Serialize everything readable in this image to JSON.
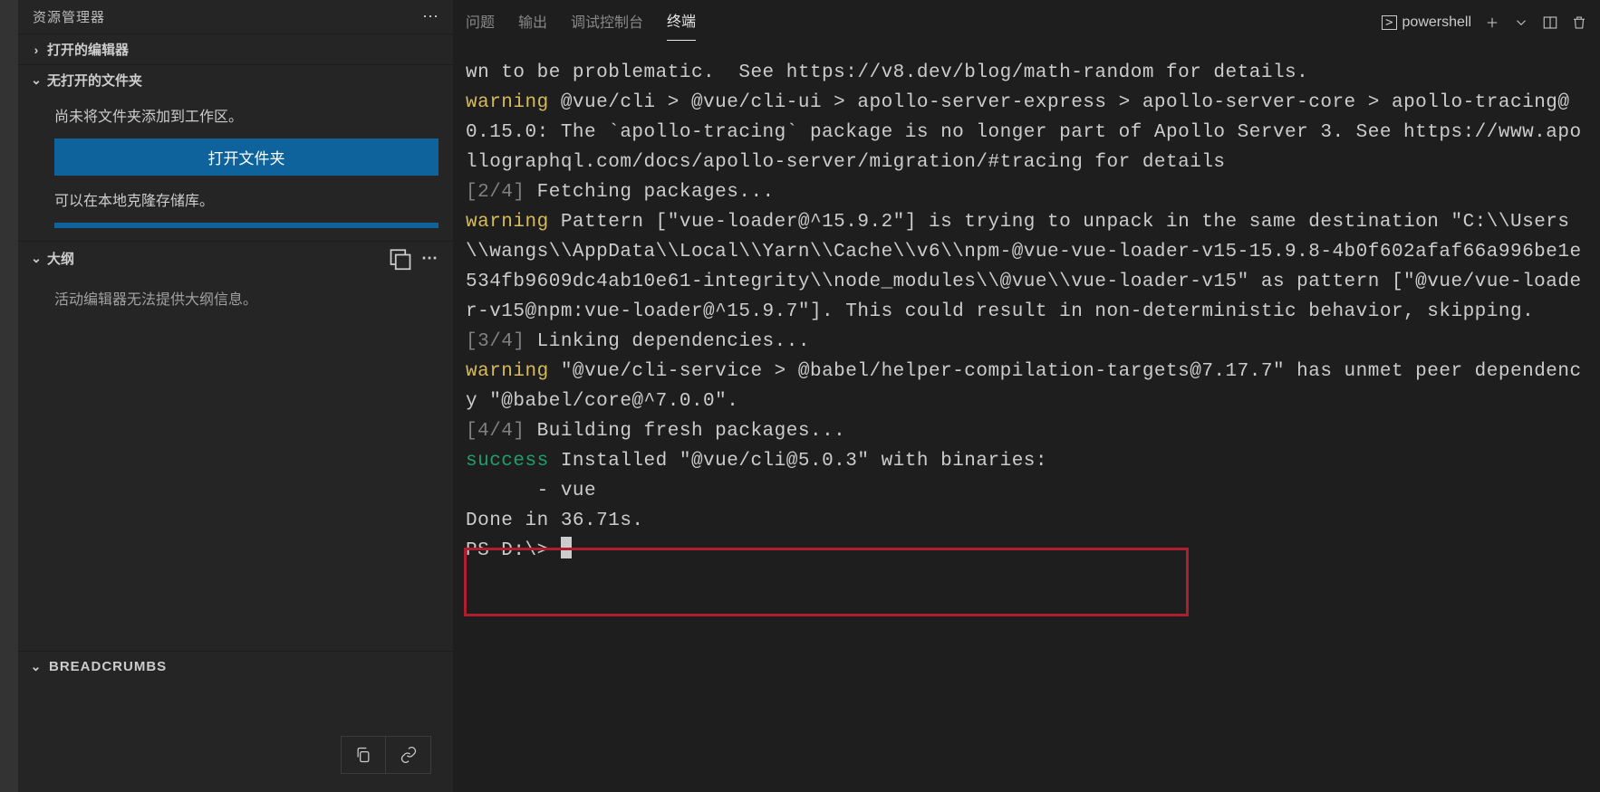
{
  "sidebar": {
    "title": "资源管理器",
    "openEditors": "打开的编辑器",
    "noFolder": "无打开的文件夹",
    "noFolderMsg": "尚未将文件夹添加到工作区。",
    "openFolderBtn": "打开文件夹",
    "cloneMsg": "可以在本地克隆存储库。",
    "outline": "大纲",
    "outlineMsg": "活动编辑器无法提供大纲信息。",
    "breadcrumbs": "BREADCRUMBS"
  },
  "panel": {
    "tabs": {
      "problems": "问题",
      "output": "输出",
      "debugConsole": "调试控制台",
      "terminal": "终端"
    },
    "shell": "powershell"
  },
  "terminal": {
    "l1": "wn to be problematic.  See https://v8.dev/blog/math-random for details.",
    "w1": "warning",
    "l2": " @vue/cli > @vue/cli-ui > apollo-server-express > apollo-server-core > apollo-tracing@0.15.0: The `apollo-tracing` package is no longer part of Apollo Server 3. See https://www.apollographql.com/docs/apollo-server/migration/#tracing for details",
    "step2": "[2/4]",
    "l3": " Fetching packages...",
    "w2": "warning",
    "l4": " Pattern [\"vue-loader@^15.9.2\"] is trying to unpack in the same destination \"C:\\\\Users\\\\wangs\\\\AppData\\\\Local\\\\Yarn\\\\Cache\\\\v6\\\\npm-@vue-vue-loader-v15-15.9.8-4b0f602afaf66a996be1e534fb9609dc4ab10e61-integrity\\\\node_modules\\\\@vue\\\\vue-loader-v15\" as pattern [\"@vue/vue-loader-v15@npm:vue-loader@^15.9.7\"]. This could result in non-deterministic behavior, skipping.",
    "step3": "[3/4]",
    "l5": " Linking dependencies...",
    "w3": "warning",
    "l6": " \"@vue/cli-service > @babel/helper-compilation-targets@7.17.7\" has unmet peer dependency \"@babel/core@^7.0.0\".",
    "step4": "[4/4]",
    "l7": " Building fresh packages...",
    "succ": "success",
    "l8": " Installed \"@vue/cli@5.0.3\" with binaries:",
    "l9": "      - vue",
    "done": "Done in 36.71s.",
    "prompt": "PS D:\\> "
  }
}
